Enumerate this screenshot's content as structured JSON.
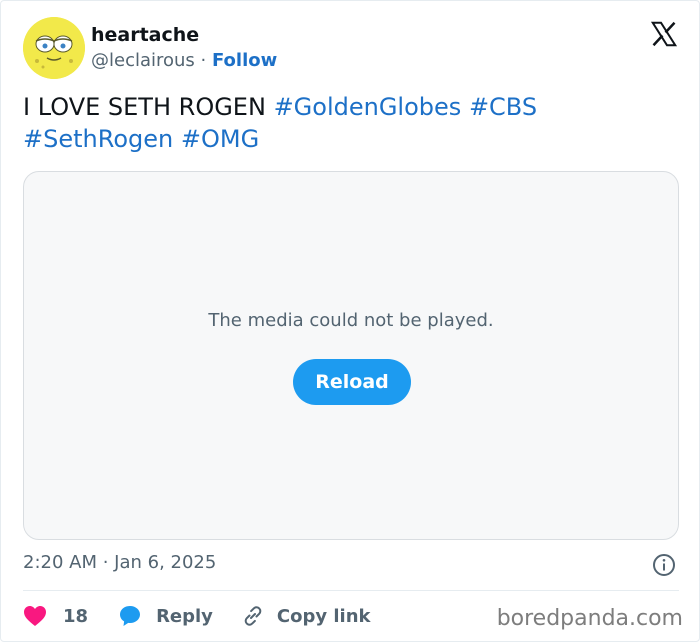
{
  "header": {
    "display_name": "heartache",
    "handle": "@leclairous",
    "separator": " · ",
    "follow_label": "Follow"
  },
  "tweet": {
    "text": "I LOVE SETH ROGEN",
    "hashtags": [
      "#GoldenGlobes",
      "#CBS",
      "#SethRogen",
      "#OMG"
    ]
  },
  "media": {
    "error_message": "The media could not be played.",
    "reload_label": "Reload"
  },
  "meta": {
    "timestamp": "2:20 AM · Jan 6, 2025"
  },
  "actions": {
    "like_count": "18",
    "reply_label": "Reply",
    "copy_link_label": "Copy link"
  },
  "watermark": "boredpanda.com",
  "colors": {
    "link": "#1d70c7",
    "reload_button": "#1d9bf0",
    "like_heart": "#f91880",
    "reply_bubble": "#1d9bf0",
    "avatar_bg": "#f2e94a"
  },
  "icons": {
    "logo": "x-logo-icon",
    "info": "info-icon",
    "like": "heart-icon",
    "reply": "speech-bubble-icon",
    "copy": "link-icon"
  }
}
